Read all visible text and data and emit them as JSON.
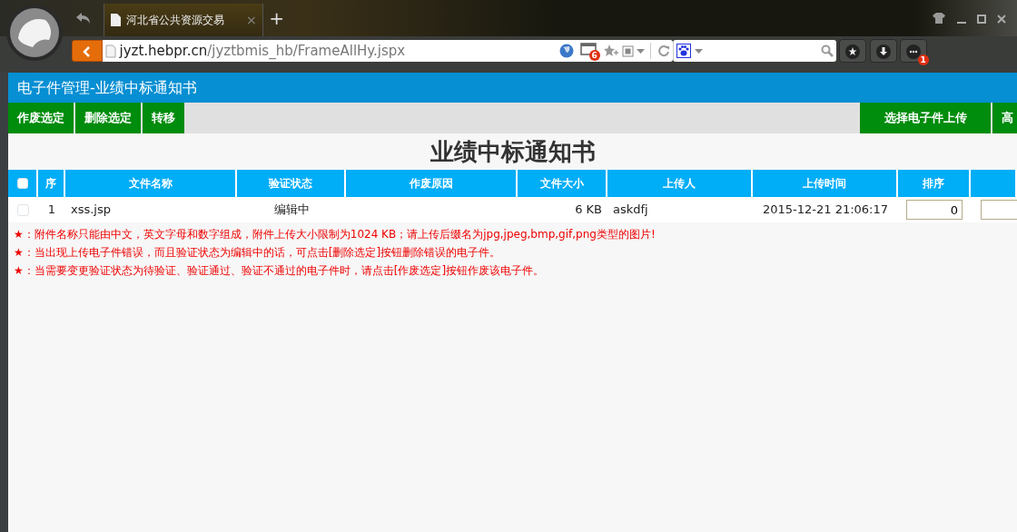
{
  "browser": {
    "tab": {
      "title": "河北省公共资源交易",
      "close": "×",
      "selected": true
    },
    "new_tab": "+",
    "address": {
      "host": "jyzt.hebpr.cn",
      "path": "/jyztbmis_hb/FrameAllHy.jspx"
    },
    "window_badge": "6",
    "menu_badge": "1"
  },
  "page": {
    "title": "电子件管理-业绩中标通知书",
    "toolbar_left": [
      "作废选定",
      "删除选定",
      "转移"
    ],
    "toolbar_right": [
      "选择电子件上传",
      "高"
    ],
    "heading": "业绩中标通知书",
    "table": {
      "select_all": {
        "checked": false
      },
      "columns": [
        "序",
        "文件名称",
        "验证状态",
        "作废原因",
        "文件大小",
        "上传人",
        "上传时间",
        "排序"
      ],
      "rows": [
        {
          "checked": false,
          "cells": [
            "1",
            "xss.jsp",
            "编辑中",
            "",
            "6 KB",
            "askdfj",
            "2015-12-21 21:06:17"
          ],
          "sort": "0"
        }
      ]
    },
    "notes": [
      "★：附件名称只能由中文，英文字母和数字组成，附件上传大小限制为1024 KB；请上传后缀名为jpg,jpeg,bmp,gif,png类型的图片!",
      "★：当出现上传电子件错误，而且验证状态为编辑中的话，可点击[删除选定]按钮删除错误的电子件。",
      "★：当需要变更验证状态为待验证、验证通过、验证不通过的电子件时，请点击[作废选定]按钮作废该电子件。"
    ]
  }
}
